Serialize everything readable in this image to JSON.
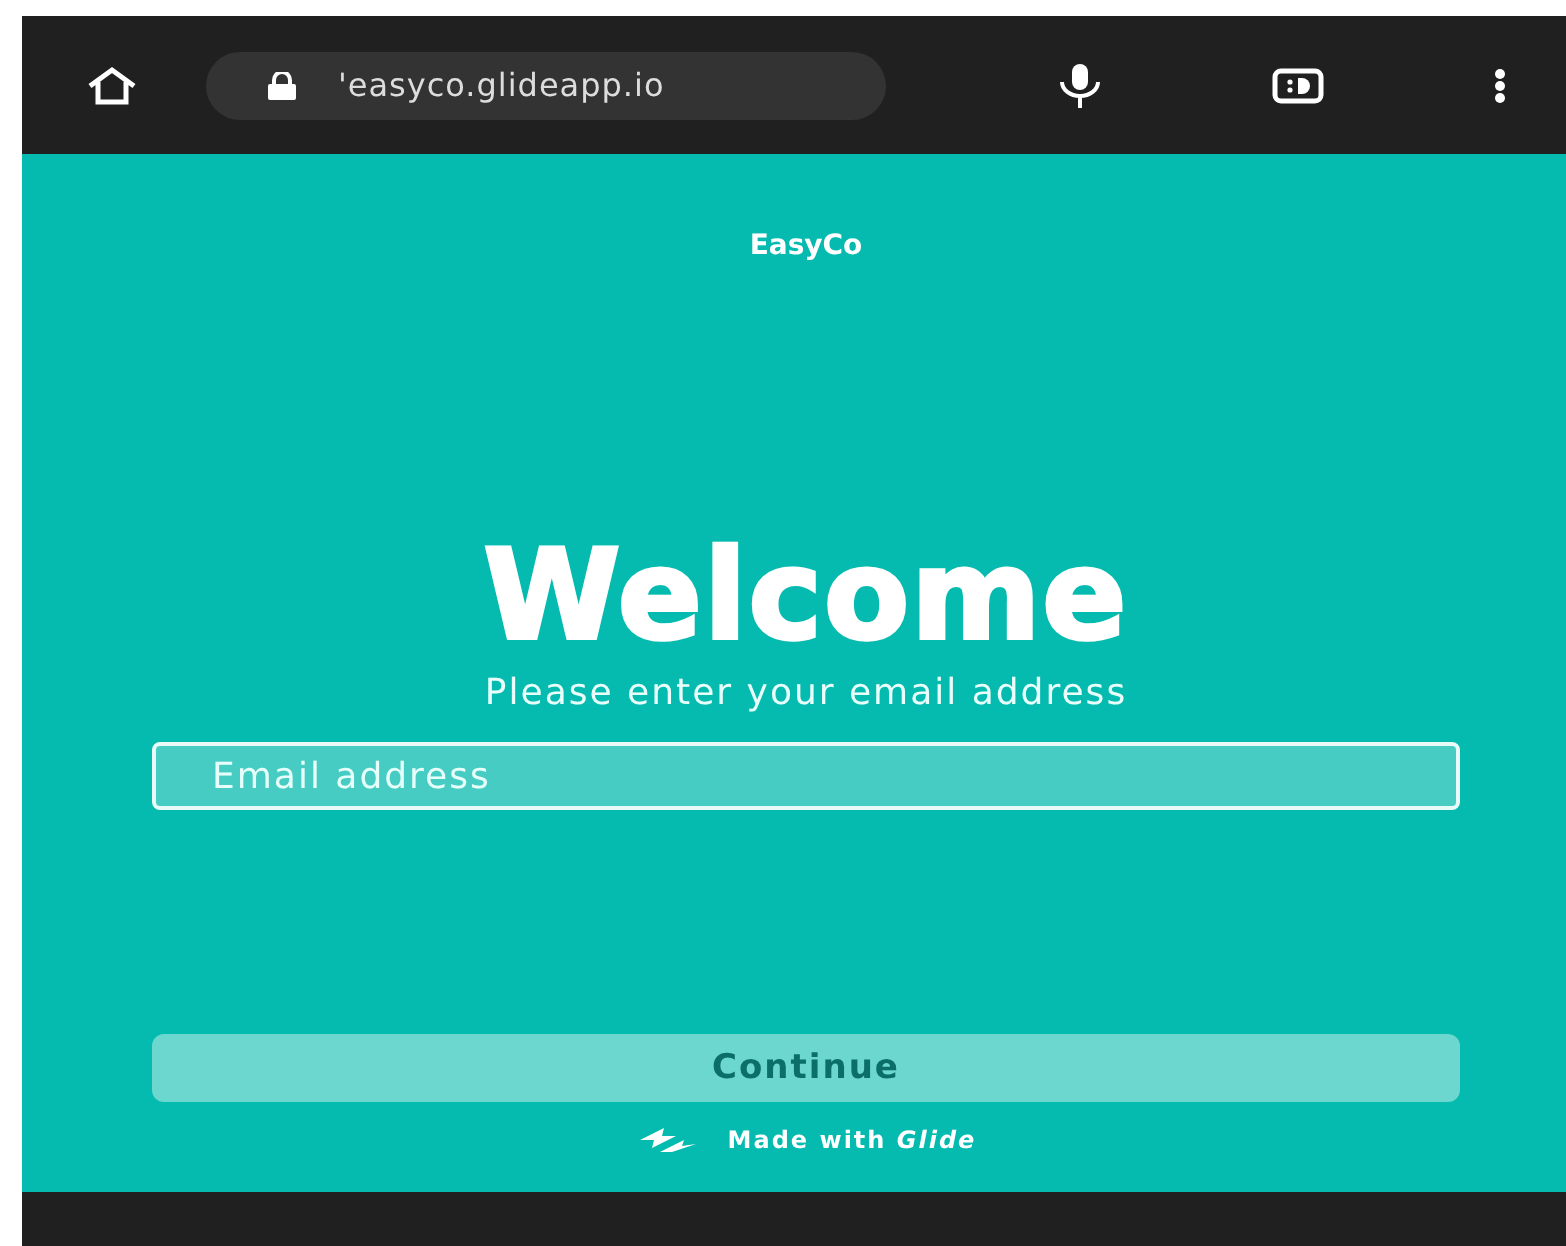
{
  "browser": {
    "url": "'easyco.glideapp.io"
  },
  "app": {
    "title": "EasyCo",
    "heading": "Welcome",
    "subtitle": "Please enter your email address",
    "email_field": {
      "placeholder": "Email address"
    },
    "continue_button": {
      "label": "Continue",
      "disabled": true
    },
    "footer": "Made with *Glide*"
  }
}
